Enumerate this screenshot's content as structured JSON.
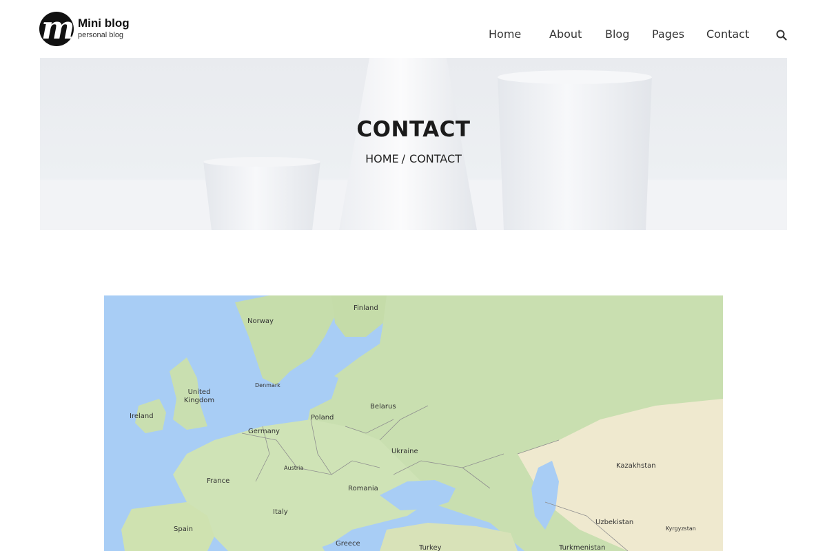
{
  "site": {
    "logo_glyph": "m",
    "title": "Mini blog",
    "subtitle": "personal blog"
  },
  "nav": {
    "items": [
      "Home",
      "About",
      "Blog",
      "Pages",
      "Contact"
    ]
  },
  "banner": {
    "title": "CONTACT",
    "breadcrumb_home": "HOME",
    "breadcrumb_sep": "/",
    "breadcrumb_current": "CONTACT"
  },
  "map": {
    "labels": [
      "Finland",
      "Norway",
      "Denmark",
      "United Kingdom",
      "Ireland",
      "Belarus",
      "Poland",
      "Germany",
      "Ukraine",
      "Kazakhstan",
      "Austria",
      "France",
      "Romania",
      "Italy",
      "Uzbekistan",
      "Spain",
      "Kyrgyzstan",
      "Greece",
      "Turkey",
      "Turkmenistan"
    ]
  },
  "colors": {
    "water": "#a8cdf5",
    "land": "#c9dfb0",
    "desert": "#efe9cf",
    "text": "#222222"
  }
}
